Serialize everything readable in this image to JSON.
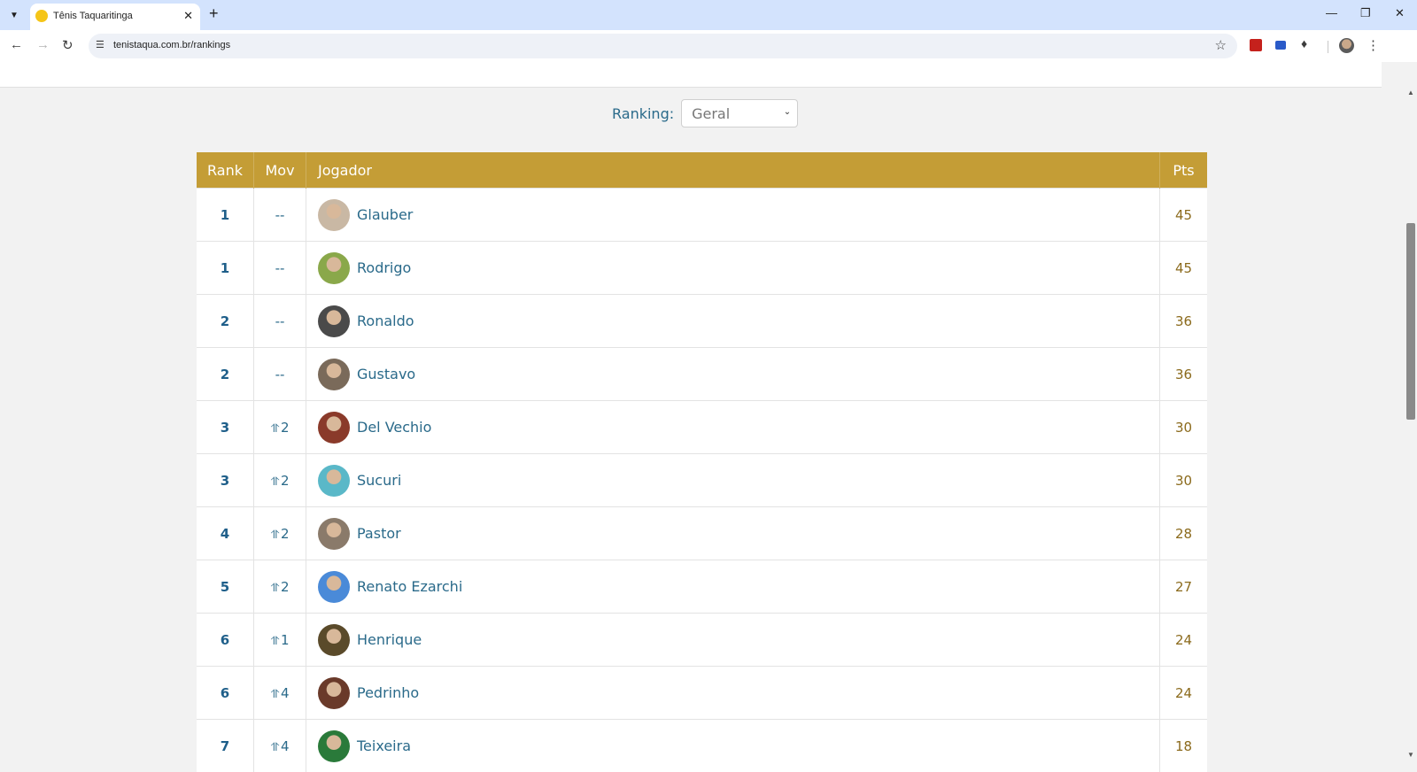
{
  "browser": {
    "tab_title": "Tênis Taquaritinga",
    "url": "tenistaqua.com.br/rankings"
  },
  "filter": {
    "label": "Ranking:",
    "selected": "Geral"
  },
  "table": {
    "headers": {
      "rank": "Rank",
      "mov": "Mov",
      "player": "Jogador",
      "pts": "Pts"
    },
    "rows": [
      {
        "rank": "1",
        "mov": "--",
        "name": "Glauber",
        "pts": "45",
        "avatar_color": "#c9b8a4"
      },
      {
        "rank": "1",
        "mov": "--",
        "name": "Rodrigo",
        "pts": "45",
        "avatar_color": "#8aa84a"
      },
      {
        "rank": "2",
        "mov": "--",
        "name": "Ronaldo",
        "pts": "36",
        "avatar_color": "#4a4a4a"
      },
      {
        "rank": "2",
        "mov": "--",
        "name": "Gustavo",
        "pts": "36",
        "avatar_color": "#7a6a5a"
      },
      {
        "rank": "3",
        "mov": "2",
        "name": "Del Vechio",
        "pts": "30",
        "avatar_color": "#8a3a2a"
      },
      {
        "rank": "3",
        "mov": "2",
        "name": "Sucuri",
        "pts": "30",
        "avatar_color": "#5ab8c8"
      },
      {
        "rank": "4",
        "mov": "2",
        "name": "Pastor",
        "pts": "28",
        "avatar_color": "#8a7a6a"
      },
      {
        "rank": "5",
        "mov": "2",
        "name": "Renato Ezarchi",
        "pts": "27",
        "avatar_color": "#4a8ad8"
      },
      {
        "rank": "6",
        "mov": "1",
        "name": "Henrique",
        "pts": "24",
        "avatar_color": "#5a4a2a"
      },
      {
        "rank": "6",
        "mov": "4",
        "name": "Pedrinho",
        "pts": "24",
        "avatar_color": "#6a3a2a"
      },
      {
        "rank": "7",
        "mov": "4",
        "name": "Teixeira",
        "pts": "18",
        "avatar_color": "#2a7a3a"
      }
    ]
  }
}
